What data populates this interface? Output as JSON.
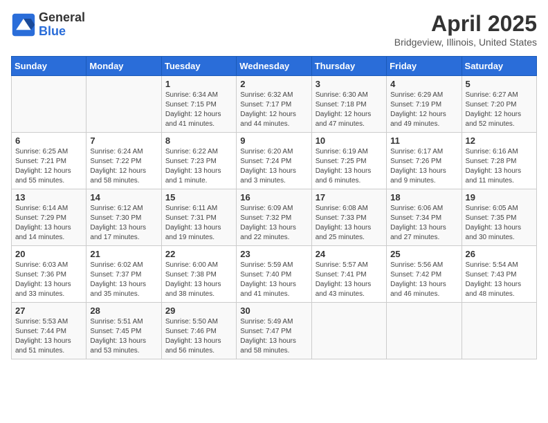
{
  "header": {
    "logo_general": "General",
    "logo_blue": "Blue",
    "title": "April 2025",
    "subtitle": "Bridgeview, Illinois, United States"
  },
  "days_of_week": [
    "Sunday",
    "Monday",
    "Tuesday",
    "Wednesday",
    "Thursday",
    "Friday",
    "Saturday"
  ],
  "weeks": [
    [
      {
        "day": "",
        "sunrise": "",
        "sunset": "",
        "daylight": ""
      },
      {
        "day": "",
        "sunrise": "",
        "sunset": "",
        "daylight": ""
      },
      {
        "day": "1",
        "sunrise": "Sunrise: 6:34 AM",
        "sunset": "Sunset: 7:15 PM",
        "daylight": "Daylight: 12 hours and 41 minutes."
      },
      {
        "day": "2",
        "sunrise": "Sunrise: 6:32 AM",
        "sunset": "Sunset: 7:17 PM",
        "daylight": "Daylight: 12 hours and 44 minutes."
      },
      {
        "day": "3",
        "sunrise": "Sunrise: 6:30 AM",
        "sunset": "Sunset: 7:18 PM",
        "daylight": "Daylight: 12 hours and 47 minutes."
      },
      {
        "day": "4",
        "sunrise": "Sunrise: 6:29 AM",
        "sunset": "Sunset: 7:19 PM",
        "daylight": "Daylight: 12 hours and 49 minutes."
      },
      {
        "day": "5",
        "sunrise": "Sunrise: 6:27 AM",
        "sunset": "Sunset: 7:20 PM",
        "daylight": "Daylight: 12 hours and 52 minutes."
      }
    ],
    [
      {
        "day": "6",
        "sunrise": "Sunrise: 6:25 AM",
        "sunset": "Sunset: 7:21 PM",
        "daylight": "Daylight: 12 hours and 55 minutes."
      },
      {
        "day": "7",
        "sunrise": "Sunrise: 6:24 AM",
        "sunset": "Sunset: 7:22 PM",
        "daylight": "Daylight: 12 hours and 58 minutes."
      },
      {
        "day": "8",
        "sunrise": "Sunrise: 6:22 AM",
        "sunset": "Sunset: 7:23 PM",
        "daylight": "Daylight: 13 hours and 1 minute."
      },
      {
        "day": "9",
        "sunrise": "Sunrise: 6:20 AM",
        "sunset": "Sunset: 7:24 PM",
        "daylight": "Daylight: 13 hours and 3 minutes."
      },
      {
        "day": "10",
        "sunrise": "Sunrise: 6:19 AM",
        "sunset": "Sunset: 7:25 PM",
        "daylight": "Daylight: 13 hours and 6 minutes."
      },
      {
        "day": "11",
        "sunrise": "Sunrise: 6:17 AM",
        "sunset": "Sunset: 7:26 PM",
        "daylight": "Daylight: 13 hours and 9 minutes."
      },
      {
        "day": "12",
        "sunrise": "Sunrise: 6:16 AM",
        "sunset": "Sunset: 7:28 PM",
        "daylight": "Daylight: 13 hours and 11 minutes."
      }
    ],
    [
      {
        "day": "13",
        "sunrise": "Sunrise: 6:14 AM",
        "sunset": "Sunset: 7:29 PM",
        "daylight": "Daylight: 13 hours and 14 minutes."
      },
      {
        "day": "14",
        "sunrise": "Sunrise: 6:12 AM",
        "sunset": "Sunset: 7:30 PM",
        "daylight": "Daylight: 13 hours and 17 minutes."
      },
      {
        "day": "15",
        "sunrise": "Sunrise: 6:11 AM",
        "sunset": "Sunset: 7:31 PM",
        "daylight": "Daylight: 13 hours and 19 minutes."
      },
      {
        "day": "16",
        "sunrise": "Sunrise: 6:09 AM",
        "sunset": "Sunset: 7:32 PM",
        "daylight": "Daylight: 13 hours and 22 minutes."
      },
      {
        "day": "17",
        "sunrise": "Sunrise: 6:08 AM",
        "sunset": "Sunset: 7:33 PM",
        "daylight": "Daylight: 13 hours and 25 minutes."
      },
      {
        "day": "18",
        "sunrise": "Sunrise: 6:06 AM",
        "sunset": "Sunset: 7:34 PM",
        "daylight": "Daylight: 13 hours and 27 minutes."
      },
      {
        "day": "19",
        "sunrise": "Sunrise: 6:05 AM",
        "sunset": "Sunset: 7:35 PM",
        "daylight": "Daylight: 13 hours and 30 minutes."
      }
    ],
    [
      {
        "day": "20",
        "sunrise": "Sunrise: 6:03 AM",
        "sunset": "Sunset: 7:36 PM",
        "daylight": "Daylight: 13 hours and 33 minutes."
      },
      {
        "day": "21",
        "sunrise": "Sunrise: 6:02 AM",
        "sunset": "Sunset: 7:37 PM",
        "daylight": "Daylight: 13 hours and 35 minutes."
      },
      {
        "day": "22",
        "sunrise": "Sunrise: 6:00 AM",
        "sunset": "Sunset: 7:38 PM",
        "daylight": "Daylight: 13 hours and 38 minutes."
      },
      {
        "day": "23",
        "sunrise": "Sunrise: 5:59 AM",
        "sunset": "Sunset: 7:40 PM",
        "daylight": "Daylight: 13 hours and 41 minutes."
      },
      {
        "day": "24",
        "sunrise": "Sunrise: 5:57 AM",
        "sunset": "Sunset: 7:41 PM",
        "daylight": "Daylight: 13 hours and 43 minutes."
      },
      {
        "day": "25",
        "sunrise": "Sunrise: 5:56 AM",
        "sunset": "Sunset: 7:42 PM",
        "daylight": "Daylight: 13 hours and 46 minutes."
      },
      {
        "day": "26",
        "sunrise": "Sunrise: 5:54 AM",
        "sunset": "Sunset: 7:43 PM",
        "daylight": "Daylight: 13 hours and 48 minutes."
      }
    ],
    [
      {
        "day": "27",
        "sunrise": "Sunrise: 5:53 AM",
        "sunset": "Sunset: 7:44 PM",
        "daylight": "Daylight: 13 hours and 51 minutes."
      },
      {
        "day": "28",
        "sunrise": "Sunrise: 5:51 AM",
        "sunset": "Sunset: 7:45 PM",
        "daylight": "Daylight: 13 hours and 53 minutes."
      },
      {
        "day": "29",
        "sunrise": "Sunrise: 5:50 AM",
        "sunset": "Sunset: 7:46 PM",
        "daylight": "Daylight: 13 hours and 56 minutes."
      },
      {
        "day": "30",
        "sunrise": "Sunrise: 5:49 AM",
        "sunset": "Sunset: 7:47 PM",
        "daylight": "Daylight: 13 hours and 58 minutes."
      },
      {
        "day": "",
        "sunrise": "",
        "sunset": "",
        "daylight": ""
      },
      {
        "day": "",
        "sunrise": "",
        "sunset": "",
        "daylight": ""
      },
      {
        "day": "",
        "sunrise": "",
        "sunset": "",
        "daylight": ""
      }
    ]
  ]
}
